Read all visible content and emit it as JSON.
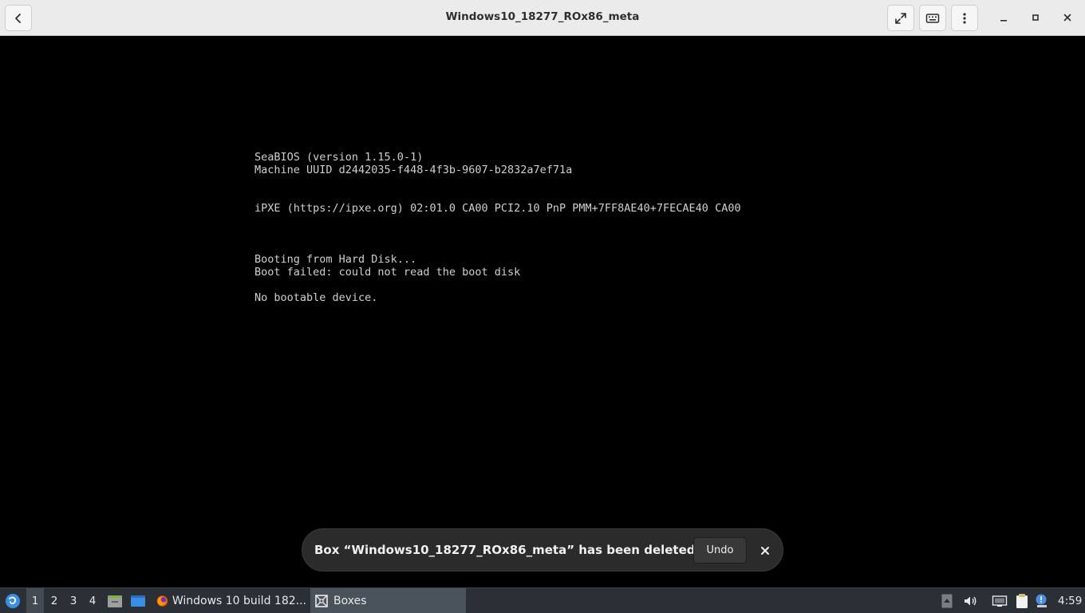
{
  "window": {
    "title": "Windows10_18277_ROx86_meta"
  },
  "console": {
    "lines": [
      "SeaBIOS (version 1.15.0-1)",
      "Machine UUID d2442035-f448-4f3b-9607-b2832a7ef71a",
      "",
      "",
      "iPXE (https://ipxe.org) 02:01.0 CA00 PCI2.10 PnP PMM+7FF8AE40+7FECAE40 CA00",
      "",
      "",
      "",
      "Booting from Hard Disk...",
      "Boot failed: could not read the boot disk",
      "",
      "No bootable device."
    ]
  },
  "toast": {
    "message": "Box “Windows10_18277_ROx86_meta” has been deleted",
    "undo_label": "Undo"
  },
  "taskbar": {
    "workspaces": [
      "1",
      "2",
      "3",
      "4"
    ],
    "active_workspace": "1",
    "tasks": [
      {
        "label": "Windows 10 build 182...",
        "icon": "firefox-icon",
        "active": false
      },
      {
        "label": "Boxes",
        "icon": "boxes-icon",
        "active": true
      }
    ],
    "clock": "4:59"
  },
  "colors": {
    "headerbar_bg": "#ebebeb",
    "console_text": "#cfcfcf",
    "toast_bg": "#2b2b2b",
    "taskbar_bg": "#2b3036",
    "start_icon": "#3a8ee6"
  }
}
